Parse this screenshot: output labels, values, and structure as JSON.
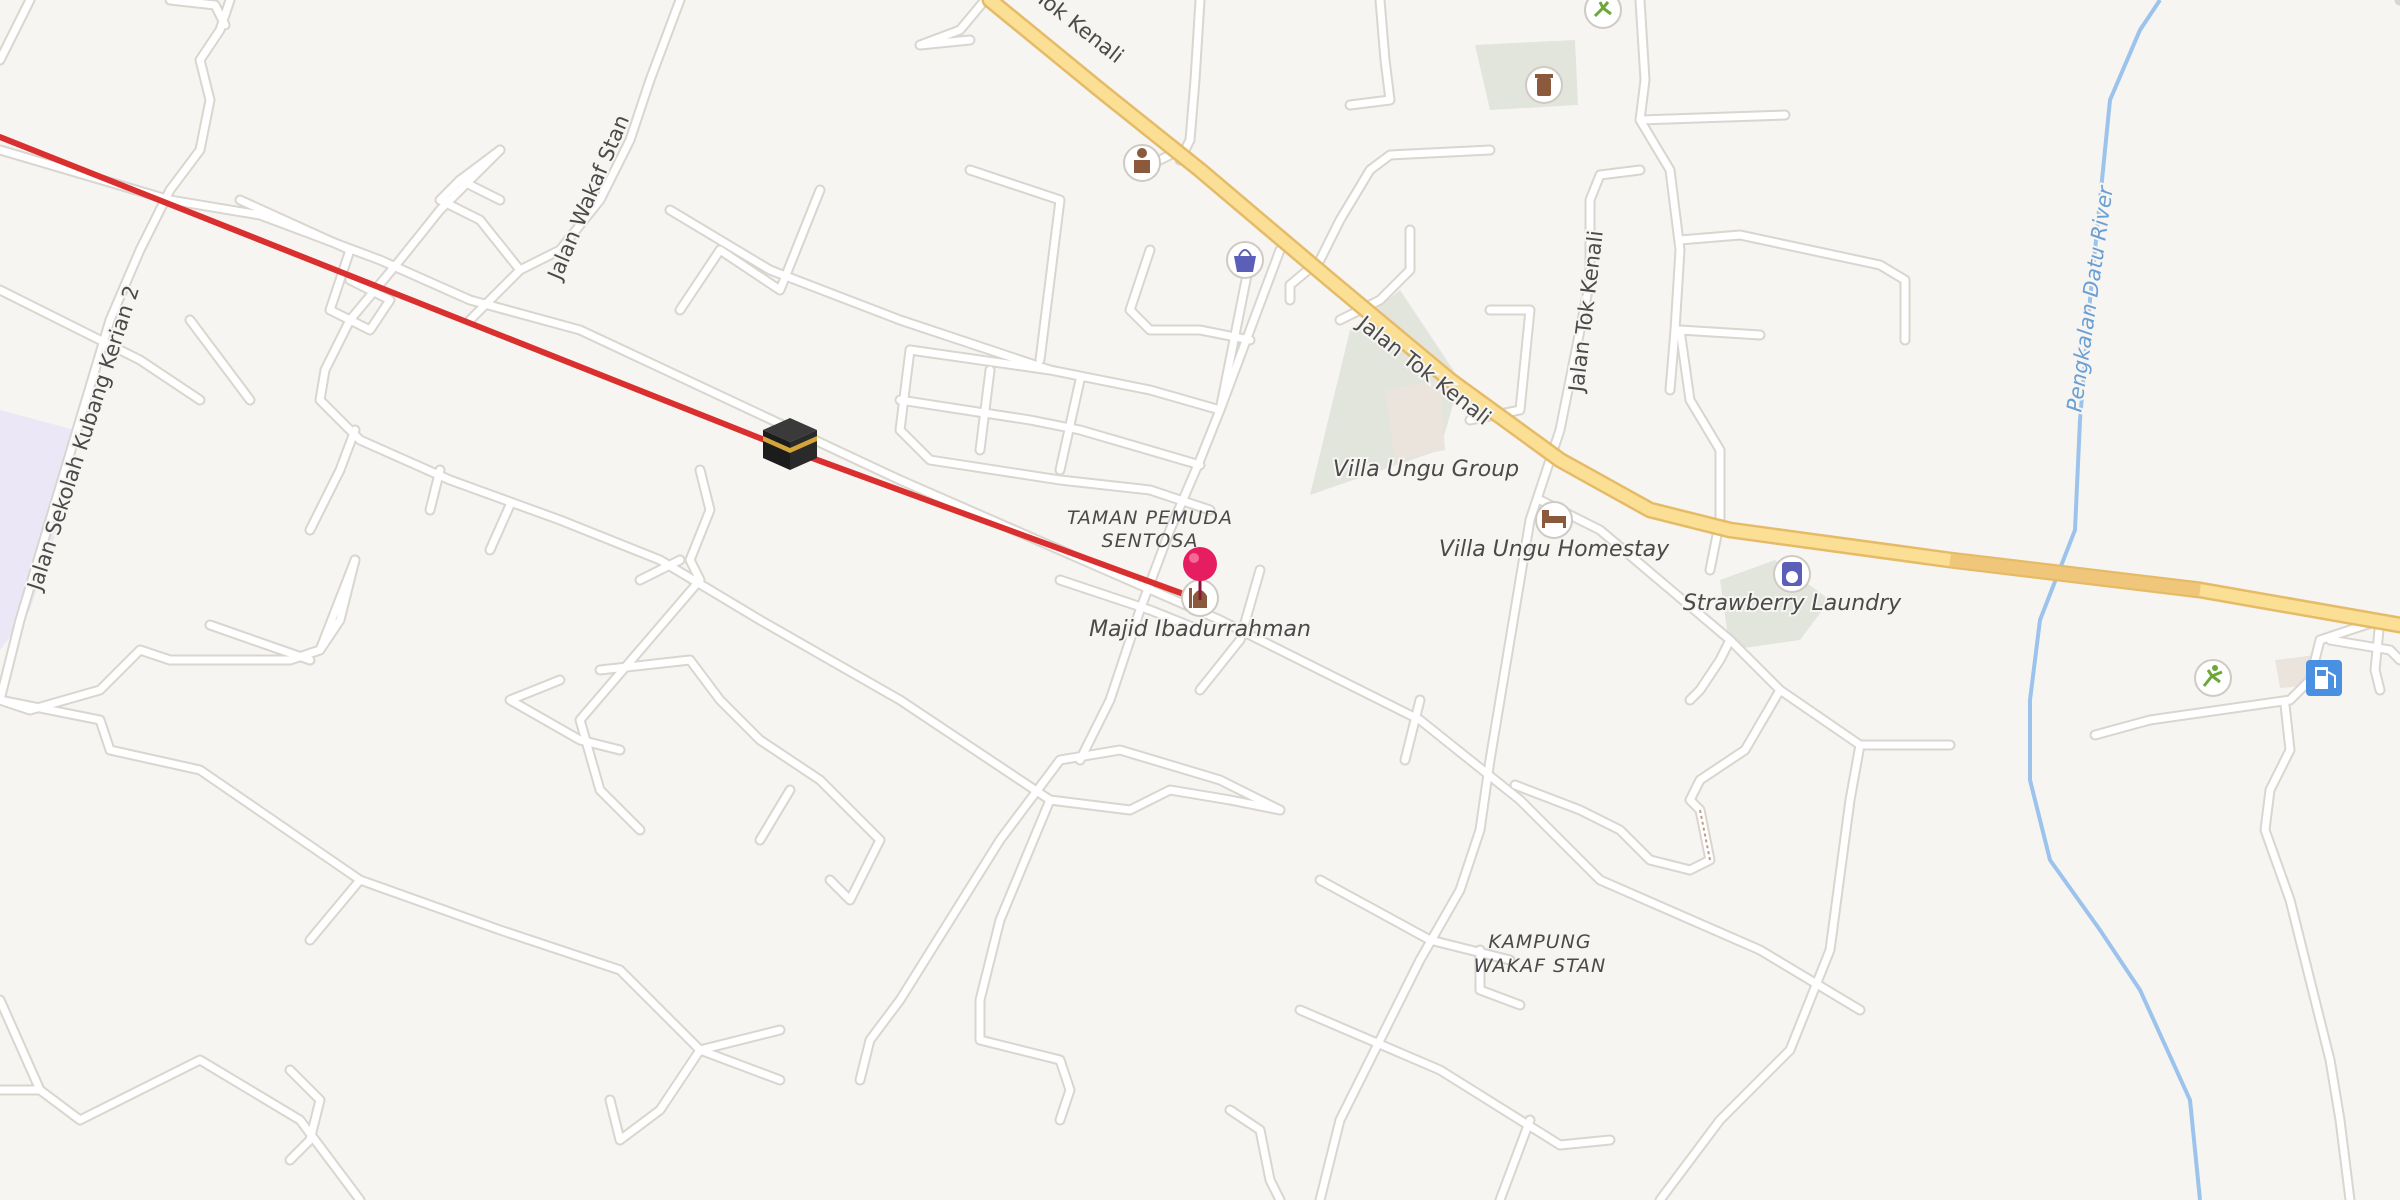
{
  "map": {
    "colors": {
      "background": "#f7f5f2",
      "road": "#ffffff",
      "road_casing": "#dcd8d2",
      "main_road": "#fbdf95",
      "main_road_casing": "#e9bf6a",
      "water": "#9cc3ec",
      "route": "#d9302f",
      "pin": "#e61d61",
      "park": "#e2e5dc",
      "residential_zone": "#ece7f7",
      "label": "#4a4a4a",
      "water_label": "#6a9fd4"
    },
    "labels": {
      "road_tok_kenali_top": "lan Tok Kenali",
      "road_tok_kenali_mid": "Jalan Tok Kenali",
      "road_wakaf_stan": "Jalan Wakaf Stan",
      "road_sekolah": "Jalan Sekolah Kubang Kerian 2",
      "road_jalan_tok_kenali_vertical": "Jalan Tok Kenali",
      "river": "Pengkalan Datu River",
      "district_taman_1": "TAMAN PEMUDA",
      "district_taman_2": "SENTOSA",
      "district_kampung_1": "KAMPUNG",
      "district_kampung_2": "WAKAF STAN"
    },
    "pois": [
      {
        "id": "majid",
        "label": "Majid Ibadurrahman",
        "icon": "mosque-icon"
      },
      {
        "id": "villa_group",
        "label": "Villa Ungu Group",
        "icon": ""
      },
      {
        "id": "villa_homestay",
        "label": "Villa Ungu Homestay",
        "icon": "bed-icon"
      },
      {
        "id": "laundry",
        "label": "Strawberry Laundry",
        "icon": "laundry-icon"
      },
      {
        "id": "attraction",
        "label": "",
        "icon": "attraction-icon"
      },
      {
        "id": "shop",
        "label": "",
        "icon": "shopping-bag-icon"
      },
      {
        "id": "doctor",
        "label": "",
        "icon": "doctor-icon"
      },
      {
        "id": "sport_1",
        "label": "",
        "icon": "sport-icon"
      },
      {
        "id": "sport_2",
        "label": "",
        "icon": "sport-icon"
      },
      {
        "id": "fuel",
        "label": "",
        "icon": "fuel-icon"
      }
    ],
    "markers": {
      "destination_pin": "location-pin-icon",
      "qibla": "kaaba-icon"
    }
  }
}
